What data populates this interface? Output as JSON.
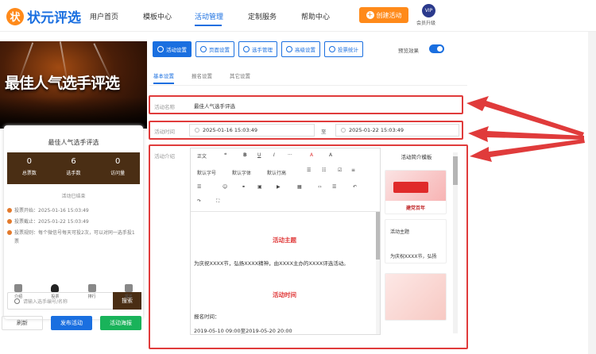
{
  "brand": {
    "mark": "状",
    "name": "状元评选"
  },
  "nav": [
    "用户首页",
    "模板中心",
    "活动管理",
    "定制服务",
    "帮助中心"
  ],
  "create_label": "创建活动",
  "vip": {
    "badge": "VIP",
    "label": "会员升级"
  },
  "banner": {
    "title": "最佳人气选手评选"
  },
  "card": {
    "title": "最佳人气选手评选",
    "stats": [
      {
        "num": "0",
        "label": "总票数"
      },
      {
        "num": "6",
        "label": "选手数"
      },
      {
        "num": "0",
        "label": "访问量"
      }
    ],
    "status": "活动已结束",
    "info": [
      "投票开始：2025-01-16 15:03:49",
      "投票截止：2025-01-22 15:03:49",
      "投票规则：每个微信号每天可投2次，可以对同一选手投1票"
    ],
    "search_placeholder": "请输入选手编号/名称",
    "search_btn": "搜索"
  },
  "tabbar": [
    "介绍",
    "投票",
    "排行",
    "报名"
  ],
  "bottom_buttons": [
    "刷新",
    "发布活动",
    "活动海报"
  ],
  "toolbar": [
    "活动设置",
    "页面设置",
    "选手管理",
    "高级设置",
    "投票统计"
  ],
  "preview_label": "预览效果",
  "subtabs": [
    "基本设置",
    "报名设置",
    "其它设置"
  ],
  "form": {
    "name_label": "活动名称",
    "name_value": "最佳人气选手评选",
    "time_label": "活动时间",
    "start": "2025-01-16 15:03:49",
    "to": "至",
    "end": "2025-01-22 15:03:49",
    "intro_label": "活动介绍"
  },
  "editor_toolbar": {
    "row1": [
      "正文",
      "❝",
      "B",
      "U",
      "I",
      "···",
      "A",
      "A"
    ],
    "row2": [
      "默认字号",
      "默认字体",
      "默认行高"
    ],
    "more": "≡"
  },
  "editor_content": {
    "h1": "活动主题",
    "p1": "为庆祝XXXX节，弘扬XXXX精神，由XXXX主办的XXXX评选活动。",
    "h2": "活动时间",
    "p2": "报名时间：",
    "p3": "2019-05-10 09:00至2019-05-20 20:00"
  },
  "templates": {
    "title": "活动简介模板",
    "items": [
      "建党百年",
      "活动主题",
      "为庆祝XXXX节，弘扬"
    ]
  },
  "colors": {
    "primary": "#1a6fe0",
    "accent": "#ff8a1a",
    "highlight": "#e03b3b",
    "dark": "#4a2e14"
  }
}
